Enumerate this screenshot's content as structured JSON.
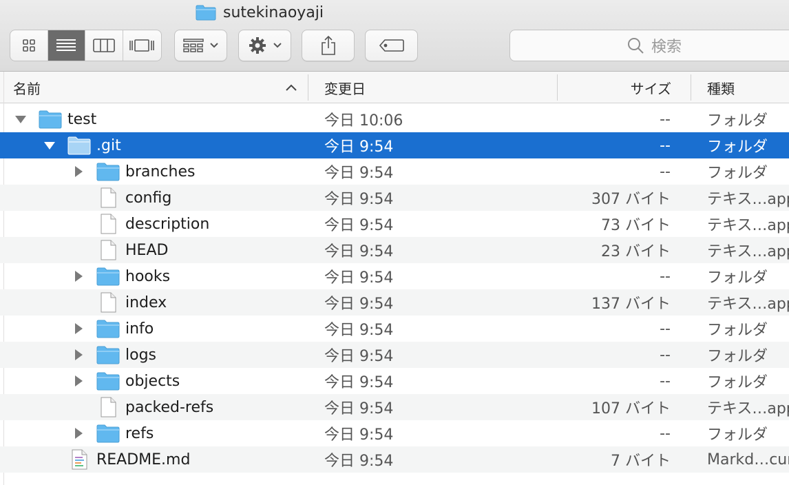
{
  "window": {
    "title": "sutekinaoyaji"
  },
  "search": {
    "placeholder": "検索"
  },
  "columns": {
    "name": "名前",
    "date": "変更日",
    "size": "サイズ",
    "kind": "種類"
  },
  "colors": {
    "selection": "#1a6fd0",
    "folder": "#61b8ef",
    "alt_row": "#f4f5f5"
  },
  "rows": [
    {
      "name": "test",
      "date": "今日 10:06",
      "size": "--",
      "kind": "フォルダ",
      "icon": "folder-icon",
      "disclosure": "open"
    },
    {
      "name": ".git",
      "date": "今日 9:54",
      "size": "--",
      "kind": "フォルダ",
      "icon": "folder-icon",
      "disclosure": "open",
      "selected": true
    },
    {
      "name": "branches",
      "date": "今日 9:54",
      "size": "--",
      "kind": "フォルダ",
      "icon": "folder-icon",
      "disclosure": "closed"
    },
    {
      "name": "config",
      "date": "今日 9:54",
      "size": "307 バイト",
      "kind": "テキス…app",
      "icon": "document-icon"
    },
    {
      "name": "description",
      "date": "今日 9:54",
      "size": "73 バイト",
      "kind": "テキス…app",
      "icon": "document-icon"
    },
    {
      "name": "HEAD",
      "date": "今日 9:54",
      "size": "23 バイト",
      "kind": "テキス…app",
      "icon": "document-icon"
    },
    {
      "name": "hooks",
      "date": "今日 9:54",
      "size": "--",
      "kind": "フォルダ",
      "icon": "folder-icon",
      "disclosure": "closed"
    },
    {
      "name": "index",
      "date": "今日 9:54",
      "size": "137 バイト",
      "kind": "テキス…app",
      "icon": "document-icon"
    },
    {
      "name": "info",
      "date": "今日 9:54",
      "size": "--",
      "kind": "フォルダ",
      "icon": "folder-icon",
      "disclosure": "closed"
    },
    {
      "name": "logs",
      "date": "今日 9:54",
      "size": "--",
      "kind": "フォルダ",
      "icon": "folder-icon",
      "disclosure": "closed"
    },
    {
      "name": "objects",
      "date": "今日 9:54",
      "size": "--",
      "kind": "フォルダ",
      "icon": "folder-icon",
      "disclosure": "closed"
    },
    {
      "name": "packed-refs",
      "date": "今日 9:54",
      "size": "107 バイト",
      "kind": "テキス…app",
      "icon": "document-icon"
    },
    {
      "name": "refs",
      "date": "今日 9:54",
      "size": "--",
      "kind": "フォルダ",
      "icon": "folder-icon",
      "disclosure": "closed"
    },
    {
      "name": "README.md",
      "date": "今日 9:54",
      "size": "7 バイト",
      "kind": "Markd…cur",
      "icon": "markdown-document-icon"
    }
  ]
}
